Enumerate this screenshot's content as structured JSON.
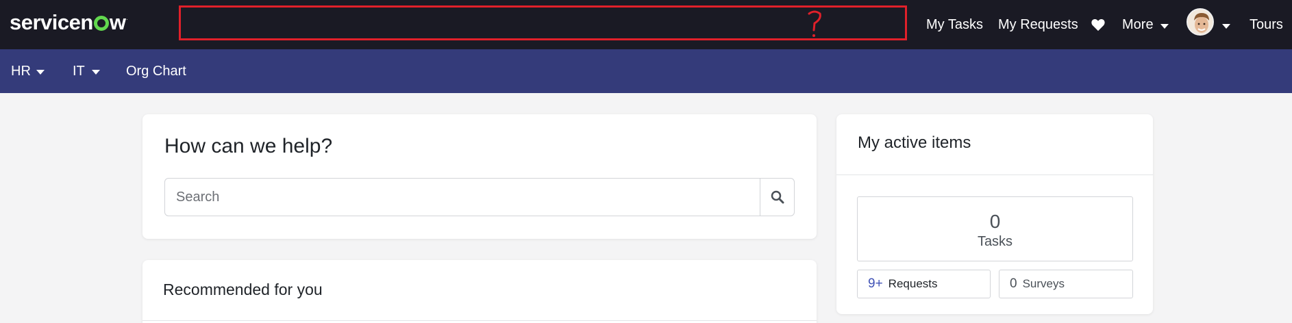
{
  "brand": {
    "logo_pre": "servicen",
    "logo_post": "w",
    "logo_tm": "."
  },
  "topnav": {
    "my_tasks": "My Tasks",
    "my_requests": "My Requests",
    "more": "More",
    "tours": "Tours",
    "favorites_icon": "heart-icon",
    "user_icon": "avatar"
  },
  "subnav": {
    "hr": "HR",
    "it": "IT",
    "org_chart": "Org Chart"
  },
  "help": {
    "title": "How can we help?",
    "search_placeholder": "Search",
    "search_icon": "search-icon"
  },
  "recommended": {
    "title": "Recommended for you"
  },
  "active": {
    "title": "My active items",
    "tasks_count": "0",
    "tasks_label": "Tasks",
    "requests_count": "9+",
    "requests_label": "Requests",
    "surveys_count": "0",
    "surveys_label": "Surveys"
  },
  "annotation": {
    "mark": "?"
  },
  "colors": {
    "header_bg": "#1a1a24",
    "subnav_bg": "#343b7a",
    "logo_accent": "#62d84e",
    "annotation_red": "#e0202a",
    "requests_blue": "#3f51b5"
  }
}
